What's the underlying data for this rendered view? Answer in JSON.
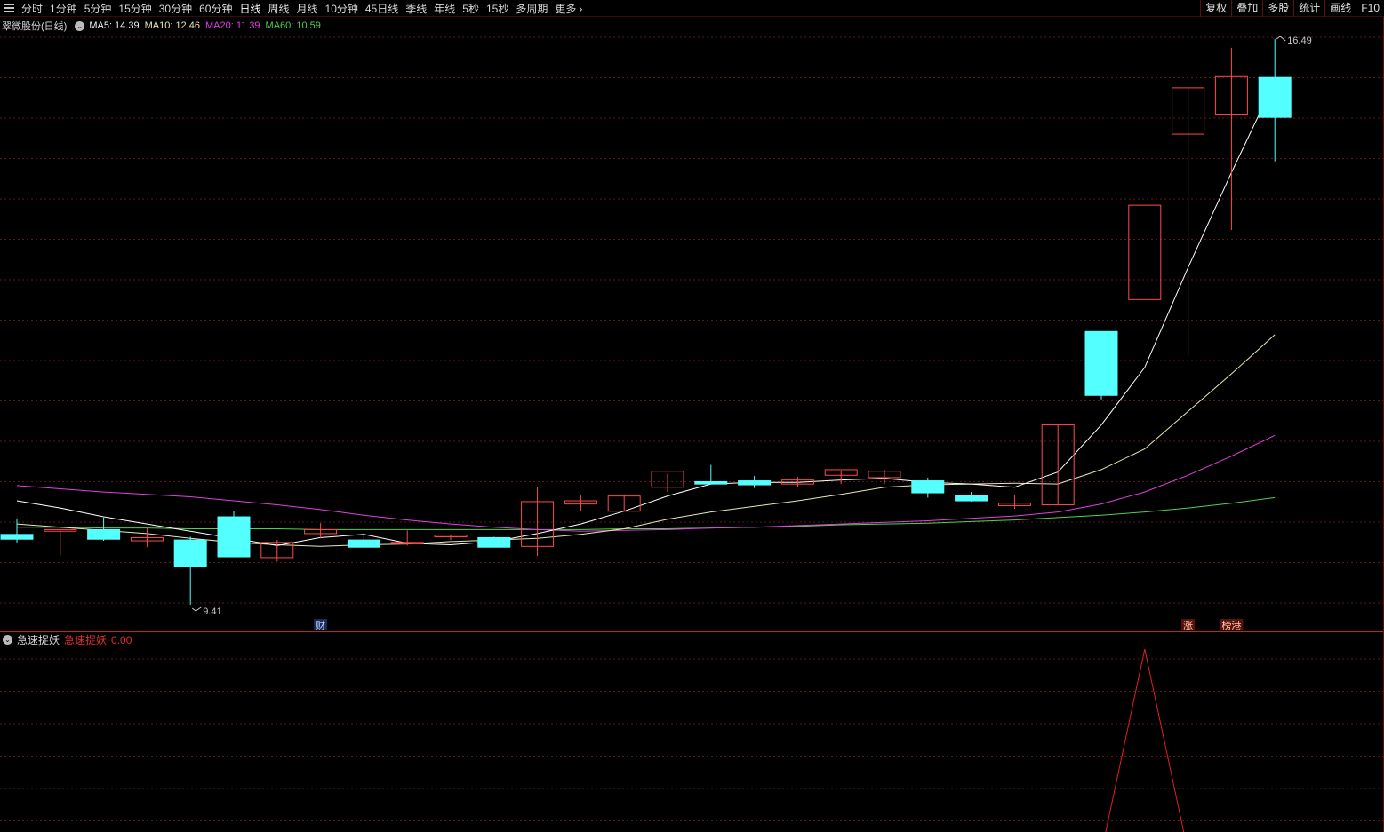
{
  "toolbar": {
    "periods": [
      "分时",
      "1分钟",
      "5分钟",
      "15分钟",
      "30分钟",
      "60分钟",
      "日线",
      "周线",
      "月线",
      "10分钟",
      "45日线",
      "季线",
      "年线",
      "5秒",
      "15秒",
      "多周期",
      "更多"
    ],
    "active_period": "日线",
    "more_chevron": "›",
    "right_buttons": [
      "复权",
      "叠加",
      "多股",
      "统计",
      "画线",
      "F10"
    ]
  },
  "chart_header": {
    "stock": "翠微股份(日线)",
    "ma5": "MA5: 14.39",
    "ma10": "MA10: 12.46",
    "ma20": "MA20: 11.39",
    "ma60": "MA60: 10.59"
  },
  "colors": {
    "up": "#ff4a4a",
    "down": "#54ffff",
    "ma5": "#ffffff",
    "ma10": "#e8e8b0",
    "ma20": "#e040e0",
    "ma60": "#50d050",
    "grid": "#5a1a1a",
    "indicator_line": "#e02020"
  },
  "chart_data": {
    "type": "candlestick",
    "ohlc": [
      {
        "o": 10.29,
        "h": 10.49,
        "l": 10.19,
        "c": 10.23
      },
      {
        "o": 10.33,
        "h": 10.34,
        "l": 10.03,
        "c": 10.35
      },
      {
        "o": 10.35,
        "h": 10.5,
        "l": 10.21,
        "c": 10.23
      },
      {
        "o": 10.21,
        "h": 10.37,
        "l": 10.13,
        "c": 10.25
      },
      {
        "o": 10.22,
        "h": 10.26,
        "l": 9.41,
        "c": 9.89
      },
      {
        "o": 10.51,
        "h": 10.58,
        "l": 10.02,
        "c": 10.01
      },
      {
        "o": 10.0,
        "h": 10.22,
        "l": 9.95,
        "c": 10.19
      },
      {
        "o": 10.3,
        "h": 10.43,
        "l": 10.24,
        "c": 10.35
      },
      {
        "o": 10.22,
        "h": 10.31,
        "l": 10.15,
        "c": 10.13
      },
      {
        "o": 10.18,
        "h": 10.34,
        "l": 10.15,
        "c": 10.19
      },
      {
        "o": 10.26,
        "h": 10.29,
        "l": 10.22,
        "c": 10.28
      },
      {
        "o": 10.25,
        "h": 10.26,
        "l": 10.13,
        "c": 10.13
      },
      {
        "o": 10.14,
        "h": 10.88,
        "l": 10.02,
        "c": 10.7
      },
      {
        "o": 10.67,
        "h": 10.79,
        "l": 10.58,
        "c": 10.71
      },
      {
        "o": 10.58,
        "h": 10.79,
        "l": 10.58,
        "c": 10.77
      },
      {
        "o": 10.88,
        "h": 11.05,
        "l": 10.82,
        "c": 11.08
      },
      {
        "o": 10.95,
        "h": 11.16,
        "l": 10.92,
        "c": 10.92
      },
      {
        "o": 10.96,
        "h": 11.02,
        "l": 10.87,
        "c": 10.91
      },
      {
        "o": 10.92,
        "h": 11.01,
        "l": 10.88,
        "c": 10.97
      },
      {
        "o": 11.03,
        "h": 11.09,
        "l": 10.92,
        "c": 11.1
      },
      {
        "o": 11.0,
        "h": 11.1,
        "l": 10.92,
        "c": 11.08
      },
      {
        "o": 10.96,
        "h": 11.0,
        "l": 10.75,
        "c": 10.81
      },
      {
        "o": 10.78,
        "h": 10.82,
        "l": 10.7,
        "c": 10.71
      },
      {
        "o": 10.65,
        "h": 10.79,
        "l": 10.61,
        "c": 10.68
      },
      {
        "o": 10.66,
        "h": 11.66,
        "l": 10.66,
        "c": 11.66
      },
      {
        "o": 12.83,
        "h": 12.83,
        "l": 11.98,
        "c": 12.03
      },
      {
        "o": 13.23,
        "h": 13.23,
        "l": 13.23,
        "c": 14.41
      },
      {
        "o": 15.3,
        "h": 15.88,
        "l": 12.52,
        "c": 15.88
      },
      {
        "o": 15.55,
        "h": 16.38,
        "l": 14.1,
        "c": 16.02
      },
      {
        "o": 16.01,
        "h": 16.49,
        "l": 14.96,
        "c": 15.51
      }
    ],
    "ma5": [
      10.71,
      10.62,
      10.51,
      10.42,
      10.33,
      10.24,
      10.15,
      10.25,
      10.29,
      10.18,
      10.16,
      10.2,
      10.3,
      10.42,
      10.58,
      10.77,
      10.92,
      10.94,
      10.94,
      10.97,
      10.99,
      10.94,
      10.92,
      10.88,
      11.07,
      11.66,
      12.38,
      13.63,
      14.82,
      15.96
    ],
    "ma10": [
      10.42,
      10.38,
      10.34,
      10.3,
      10.24,
      10.19,
      10.16,
      10.14,
      10.16,
      10.17,
      10.2,
      10.22,
      10.24,
      10.29,
      10.36,
      10.48,
      10.57,
      10.64,
      10.71,
      10.79,
      10.88,
      10.91,
      10.92,
      10.93,
      10.92,
      11.1,
      11.36,
      11.83,
      12.3,
      12.79
    ],
    "ma20": [
      10.9,
      10.86,
      10.82,
      10.79,
      10.76,
      10.71,
      10.66,
      10.6,
      10.53,
      10.47,
      10.42,
      10.38,
      10.35,
      10.33,
      10.34,
      10.35,
      10.37,
      10.38,
      10.4,
      10.42,
      10.44,
      10.46,
      10.49,
      10.52,
      10.57,
      10.67,
      10.82,
      11.03,
      11.27,
      11.53
    ],
    "ma60": [
      10.38,
      10.38,
      10.37,
      10.37,
      10.36,
      10.36,
      10.36,
      10.35,
      10.35,
      10.35,
      10.35,
      10.35,
      10.35,
      10.35,
      10.36,
      10.36,
      10.37,
      10.38,
      10.39,
      10.41,
      10.42,
      10.43,
      10.45,
      10.47,
      10.5,
      10.53,
      10.57,
      10.62,
      10.68,
      10.75
    ],
    "high_label": "16.49",
    "low_label": "9.41",
    "markers": [
      {
        "index": 7,
        "text": "财"
      },
      {
        "index": 27,
        "text": "涨"
      },
      {
        "index": 28,
        "text": "榜港"
      }
    ],
    "indicator": {
      "name": "急速捉妖",
      "label": "急速捉妖",
      "value": "0.00",
      "values": [
        0,
        0,
        0,
        0,
        0,
        0,
        0,
        0,
        0,
        0,
        0,
        0,
        0,
        0,
        0,
        0,
        0,
        0,
        0,
        0,
        0,
        0,
        0,
        0,
        0,
        0,
        1,
        0,
        0,
        0
      ]
    }
  }
}
